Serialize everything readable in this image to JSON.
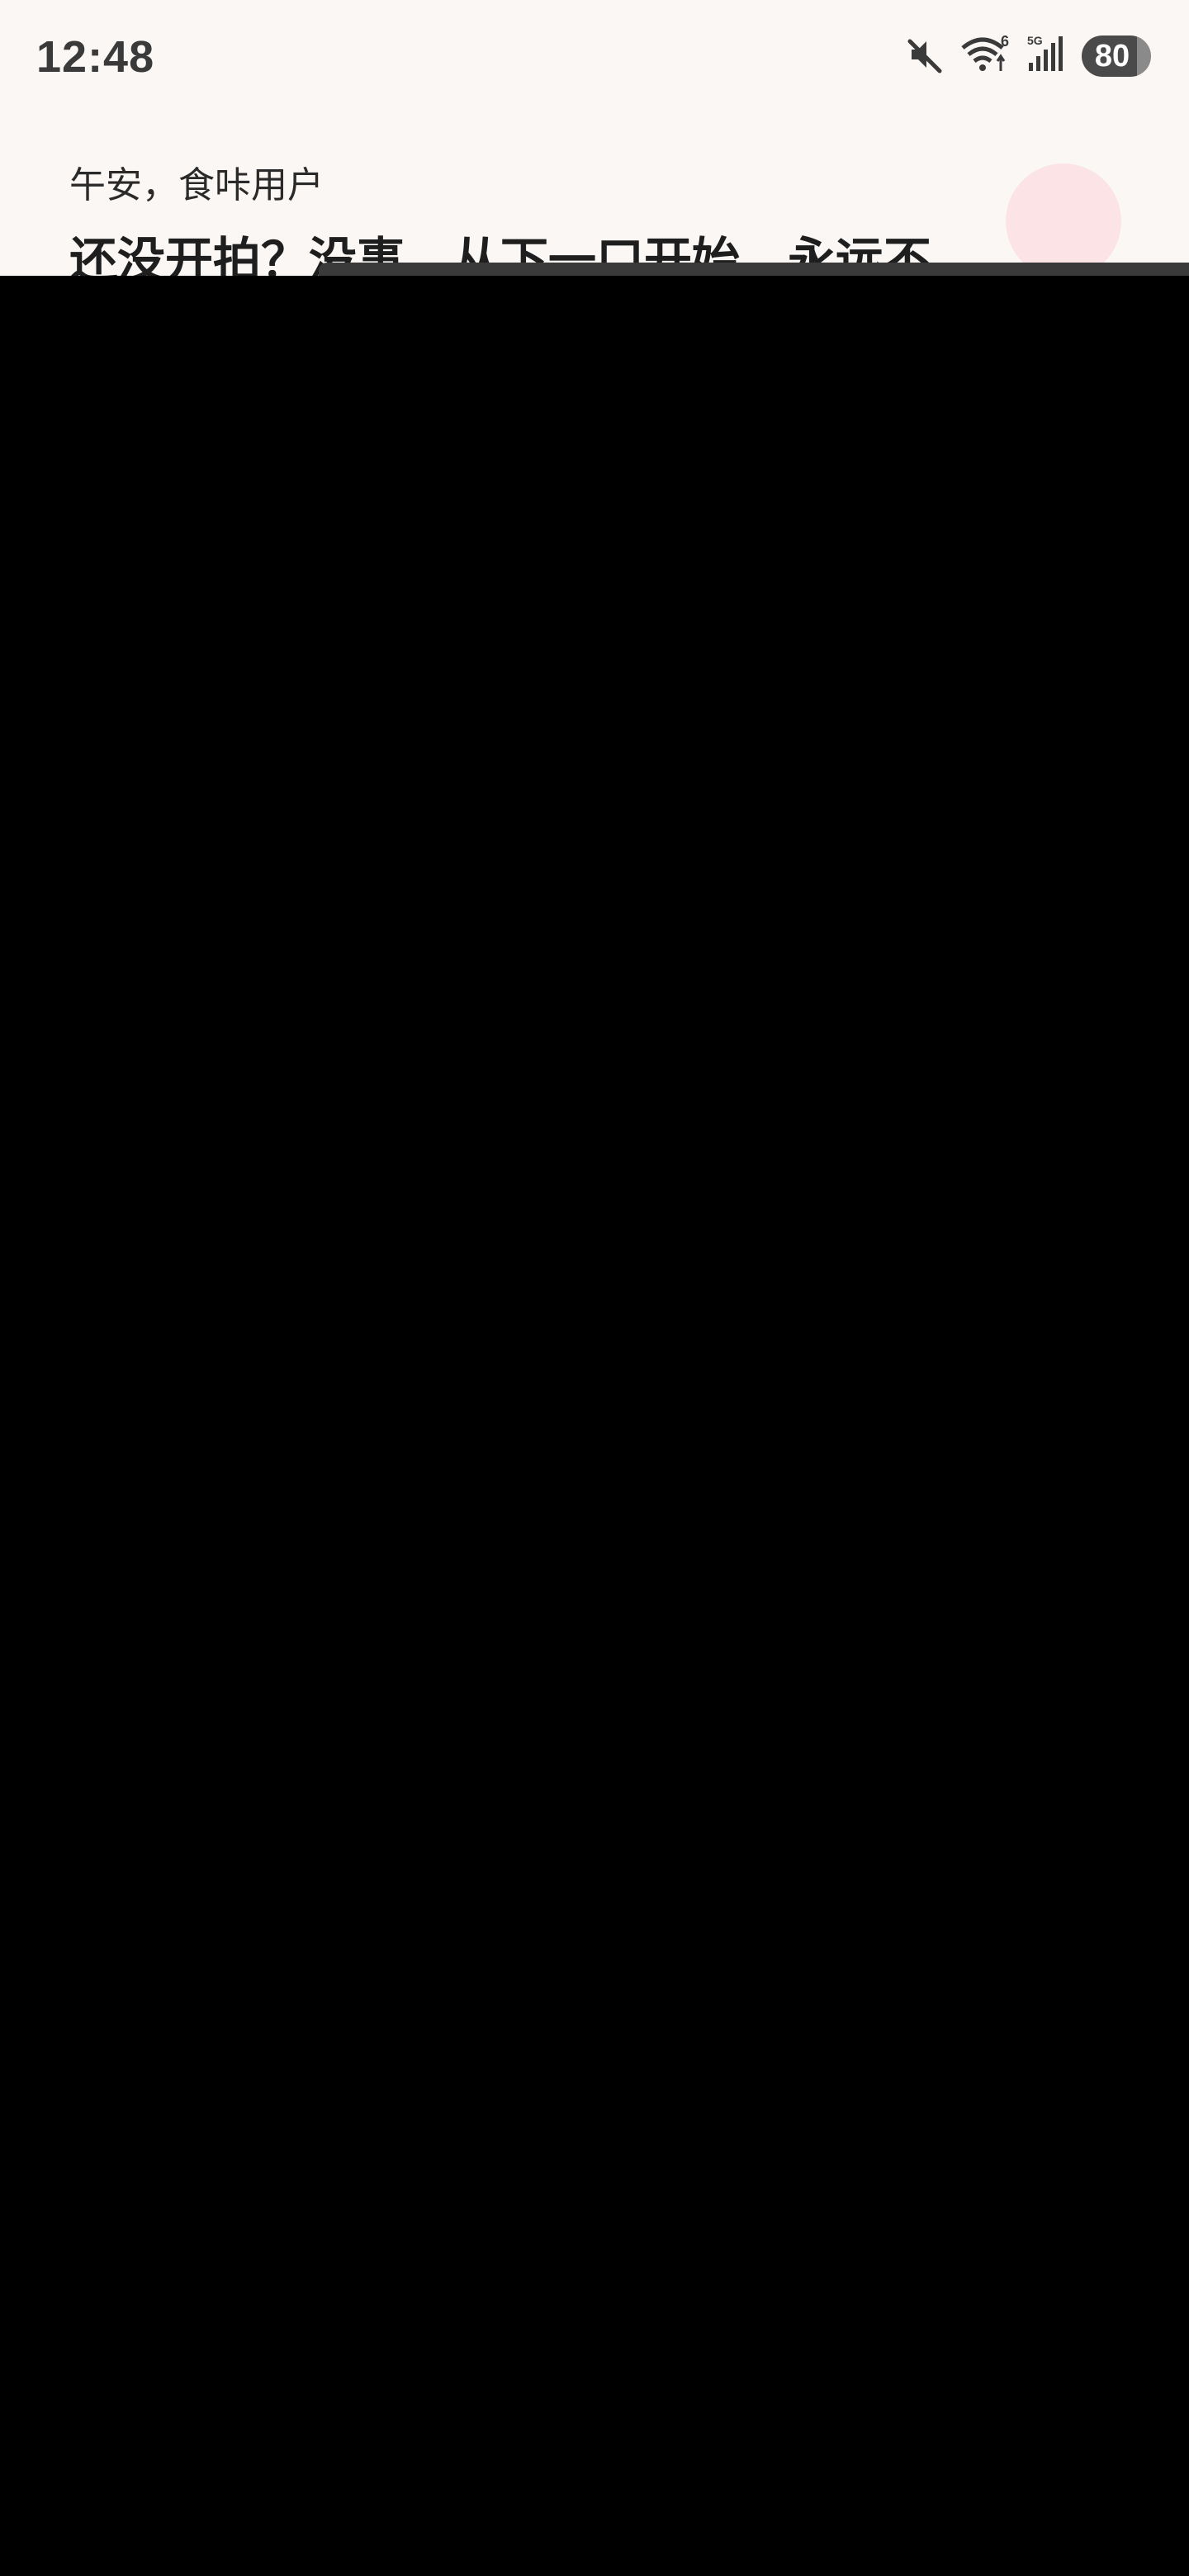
{
  "status_bar": {
    "time": "12:48",
    "wifi_label": "6",
    "network_label": "5G",
    "battery_level": "80",
    "icons": [
      "mute-icon",
      "wifi-icon",
      "signal-icon",
      "battery-icon"
    ]
  },
  "header": {
    "greeting": "午安，食咔用户",
    "headline": "还没开拍？没事，从下一口开始，永远不"
  },
  "colors": {
    "background": "#faf7f5",
    "overlay": "#000000",
    "avatar": "#fbe3e6",
    "text_primary": "#1e1e1e"
  }
}
